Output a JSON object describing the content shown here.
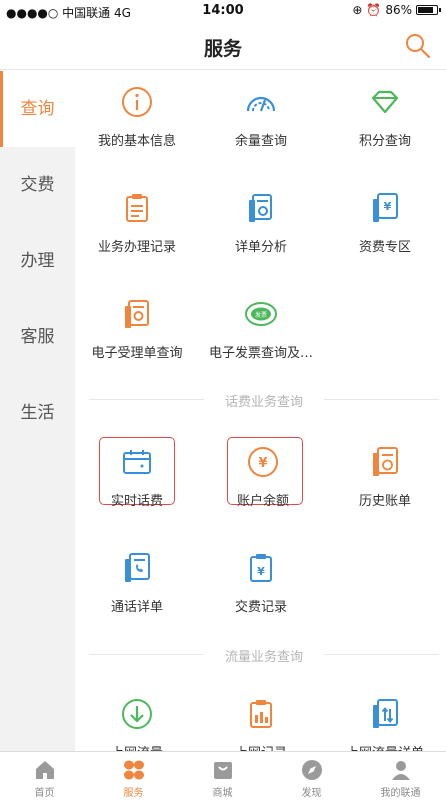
{
  "status_bar": {
    "carrier": "●●●●○ 中国联通  4G",
    "time": "14:00",
    "battery": "86%",
    "battery_level": 0.86
  },
  "header": {
    "title": "服务"
  },
  "sidebar": {
    "items": [
      {
        "label": "查询",
        "active": true
      },
      {
        "label": "交费"
      },
      {
        "label": "办理"
      },
      {
        "label": "客服"
      },
      {
        "label": "生活"
      }
    ]
  },
  "query": {
    "items": [
      {
        "label": "我的基本信息",
        "icon": "info-icon"
      },
      {
        "label": "余量查询",
        "icon": "gauge-icon"
      },
      {
        "label": "积分查询",
        "icon": "diamond-icon"
      },
      {
        "label": "业务办理记录",
        "icon": "clipboard-icon"
      },
      {
        "label": "详单分析",
        "icon": "document-chart-icon"
      },
      {
        "label": "资费专区",
        "icon": "yuan-document-icon"
      },
      {
        "label": "电子受理单查询",
        "icon": "receipt-icon"
      },
      {
        "label": "电子发票查询及…",
        "icon": "invoice-icon"
      }
    ]
  },
  "fee_section": {
    "title": "话费业务查询",
    "items": [
      {
        "label": "实时话费",
        "icon": "calendar-icon"
      },
      {
        "label": "账户余额",
        "icon": "yuan-coin-icon"
      },
      {
        "label": "历史账单",
        "icon": "clock-document-icon"
      },
      {
        "label": "通话详单",
        "icon": "call-document-icon"
      },
      {
        "label": "交费记录",
        "icon": "yuan-clipboard-icon"
      }
    ]
  },
  "traffic_section": {
    "title": "流量业务查询",
    "items": [
      {
        "label": "上网流量",
        "icon": "download-circle-icon"
      },
      {
        "label": "上网记录",
        "icon": "bar-clipboard-icon"
      },
      {
        "label": "上网流量详单",
        "icon": "transfer-document-icon"
      }
    ]
  },
  "tabbar": {
    "items": [
      {
        "label": "首页",
        "icon": "home-icon"
      },
      {
        "label": "服务",
        "icon": "service-icon",
        "active": true
      },
      {
        "label": "商城",
        "icon": "shop-icon"
      },
      {
        "label": "发现",
        "icon": "compass-icon"
      },
      {
        "label": "我的联通",
        "icon": "user-icon"
      }
    ]
  },
  "colors": {
    "accent": "#f0853d",
    "blue": "#3a8fd9",
    "green": "#4cb85a",
    "red_box": "#e34a4a"
  }
}
